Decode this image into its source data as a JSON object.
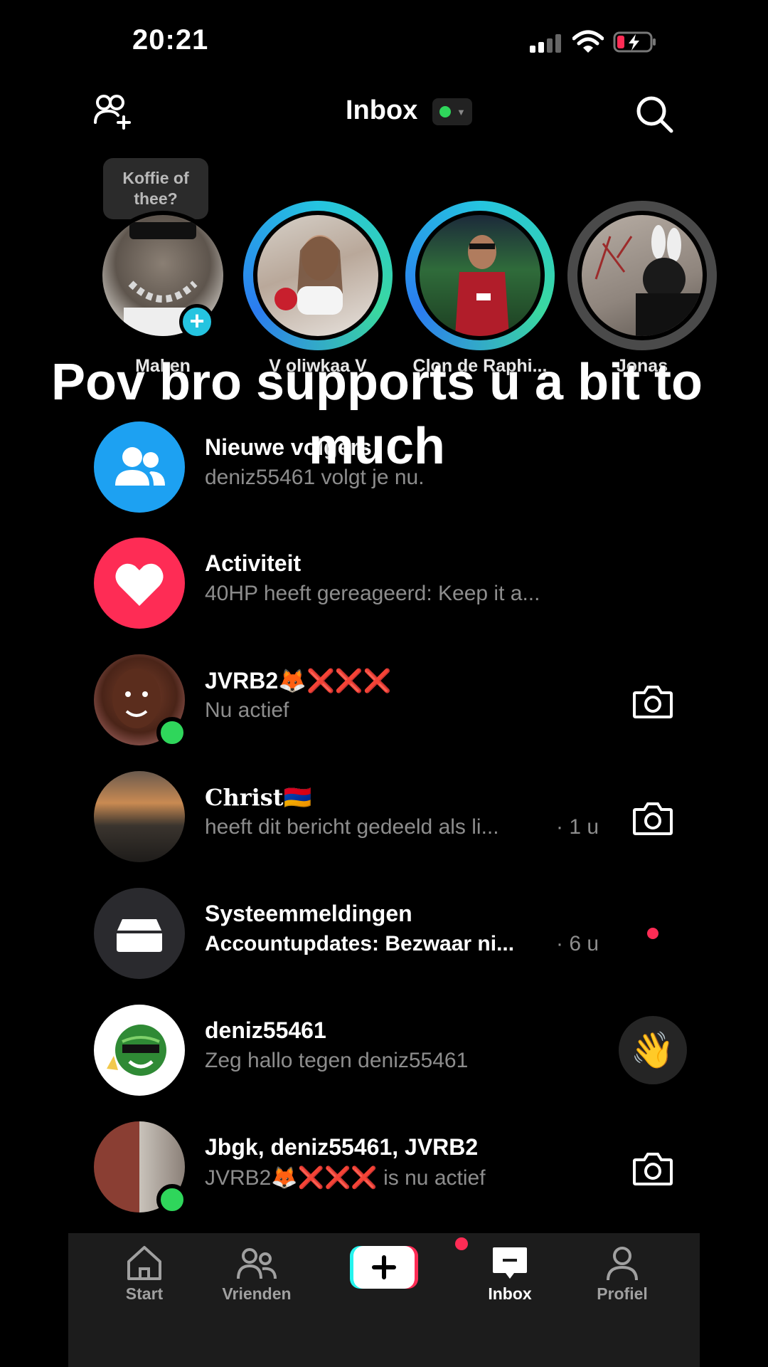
{
  "status_bar": {
    "time": "20:21"
  },
  "header": {
    "title": "Inbox"
  },
  "stories": {
    "bubble": "Koffie of thee?",
    "items": [
      {
        "name": "Maken"
      },
      {
        "name": "V oliwkaa V"
      },
      {
        "name": "Clon de Raphi..."
      },
      {
        "name": "Jonas"
      }
    ]
  },
  "caption": "Pov bro supports u a bit to much",
  "rows": [
    {
      "title": "Nieuwe volgers",
      "subtitle": "deniz55461 volgt je nu.",
      "time": ""
    },
    {
      "title": "Activiteit",
      "subtitle": "40HP heeft gereageerd: Keep it a...",
      "time": ""
    },
    {
      "title": "JVRB2🦊❌❌❌",
      "subtitle": "Nu actief",
      "time": ""
    },
    {
      "title": "Christ🇦🇲",
      "subtitle": "heeft dit bericht gedeeld als li...",
      "time": "· 1 u"
    },
    {
      "title": "Systeemmeldingen",
      "subtitle": "Accountupdates: Bezwaar ni...",
      "time": "· 6 u"
    },
    {
      "title": "deniz55461",
      "subtitle": "Zeg hallo tegen deniz55461",
      "time": ""
    },
    {
      "title": "Jbgk, deniz55461, JVRB2",
      "subtitle": "JVRB2🦊❌❌❌ is nu actief",
      "time": ""
    }
  ],
  "nav": {
    "start": "Start",
    "friends": "Vrienden",
    "inbox": "Inbox",
    "profile": "Profiel"
  },
  "colors": {
    "accent_pink": "#fe2c55",
    "accent_cyan": "#25f4ee",
    "online_green": "#2fd65b",
    "followers_blue": "#1da1f2"
  }
}
